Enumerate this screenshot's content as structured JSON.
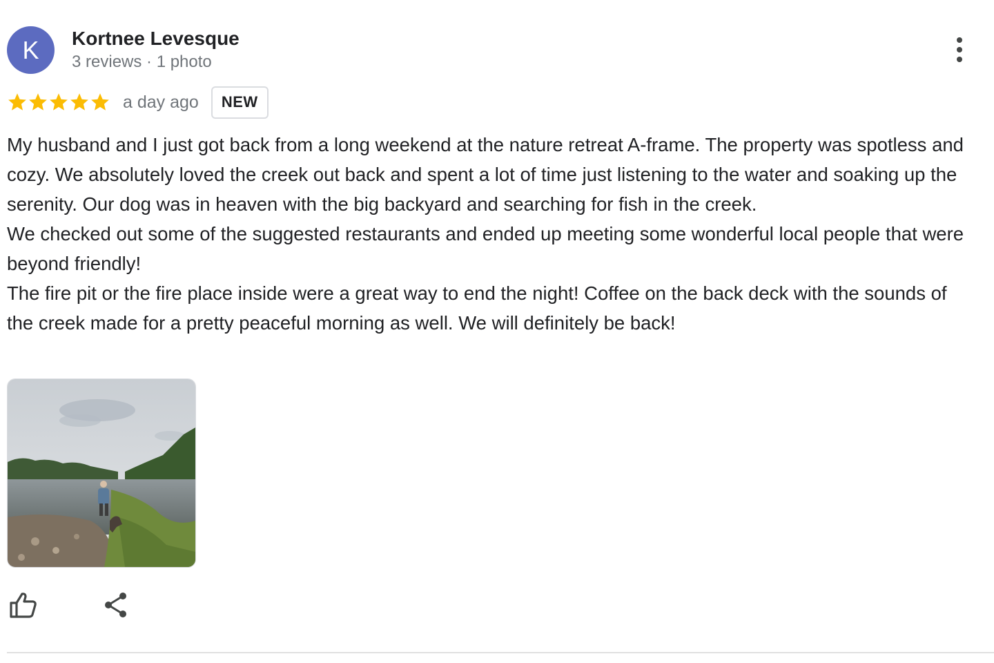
{
  "author": {
    "initial": "K",
    "name": "Kortnee Levesque",
    "meta": "3 reviews · 1 photo",
    "avatar_color": "#5c6bc0"
  },
  "rating": {
    "stars": 5,
    "max": 5,
    "star_color": "#fbbc04",
    "time": "a day ago",
    "badge": "NEW"
  },
  "review": {
    "paragraphs": [
      "My husband and I just got back from a long weekend at the nature retreat A-frame. The property was spotless and cozy. We absolutely loved the creek out back and spent a lot of time just listening to the water and soaking up the serenity. Our dog was in heaven with the big backyard and searching for fish in the creek.",
      "We checked out some of the suggested restaurants and ended up meeting some wonderful local people that were beyond friendly!",
      "The fire pit or the fire place inside were a great way to end the night! Coffee on the back deck with the sounds of the creek made for a pretty peaceful morning as well. We will definitely be back!"
    ]
  },
  "icons": {
    "more": "more-vert-icon",
    "like": "thumb-up-icon",
    "share": "share-icon"
  }
}
